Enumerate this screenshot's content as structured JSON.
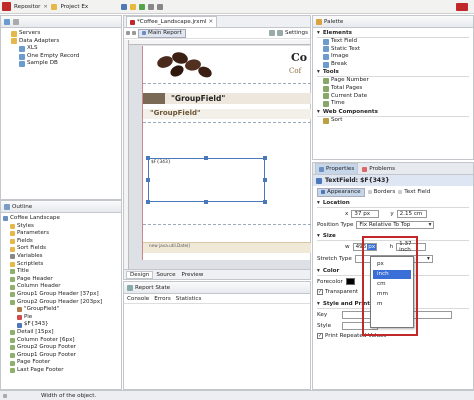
{
  "toolbar": {
    "repo_tab": "Repositor",
    "project_tab": "Project Ex"
  },
  "repository": {
    "items": [
      {
        "label": "Servers",
        "indent": 1
      },
      {
        "label": "Data Adapters",
        "indent": 1
      },
      {
        "label": "XLS",
        "indent": 2
      },
      {
        "label": "One Empty Record",
        "indent": 2
      },
      {
        "label": "Sample DB",
        "indent": 2
      }
    ]
  },
  "editor": {
    "tab_label": "*Coffee_Landscape.jrxml",
    "main_report": "Main Report",
    "settings": "Settings",
    "coffee_text": "Co",
    "coffee_sub": "Cof",
    "group_field_1": "\"GroupField\"",
    "group_field_2": "\"GroupField\"",
    "text_field_ref": "$F{343}",
    "footer_expr": "new java.util.Date()",
    "bottom_tabs": [
      "Design",
      "Source",
      "Preview"
    ]
  },
  "outline": {
    "title": "Outline",
    "items": [
      {
        "label": "Coffee Landscape",
        "indent": 0,
        "icon": "report-icon"
      },
      {
        "label": "Styles",
        "indent": 1,
        "icon": "folder-icon"
      },
      {
        "label": "Parameters",
        "indent": 1,
        "icon": "folder-icon"
      },
      {
        "label": "Fields",
        "indent": 1,
        "icon": "folder-icon"
      },
      {
        "label": "Sort Fields",
        "indent": 1,
        "icon": "folder-icon"
      },
      {
        "label": "Variables",
        "indent": 1,
        "icon": "fx-icon"
      },
      {
        "label": "Scriptlets",
        "indent": 1,
        "icon": "folder-icon"
      },
      {
        "label": "Title",
        "indent": 1,
        "icon": "band-icon"
      },
      {
        "label": "Page Header",
        "indent": 1,
        "icon": "band-icon"
      },
      {
        "label": "Column Header",
        "indent": 1,
        "icon": "band-icon"
      },
      {
        "label": "Group1 Group Header [37px]",
        "indent": 1,
        "icon": "band-icon"
      },
      {
        "label": "Group2 Group Header [203px]",
        "indent": 1,
        "icon": "band-icon"
      },
      {
        "label": "\"GroupField\"",
        "indent": 2,
        "icon": "text-icon"
      },
      {
        "label": "Pie",
        "indent": 2,
        "icon": "pie-icon"
      },
      {
        "label": "$F{343}",
        "indent": 2,
        "icon": "textfield-icon"
      },
      {
        "label": "Detail [15px]",
        "indent": 1,
        "icon": "band-icon"
      },
      {
        "label": "Column Footer [6px]",
        "indent": 1,
        "icon": "band-icon"
      },
      {
        "label": "Group2 Group Footer",
        "indent": 1,
        "icon": "band-icon"
      },
      {
        "label": "Group1 Group Footer",
        "indent": 1,
        "icon": "band-icon"
      },
      {
        "label": "Page Footer",
        "indent": 1,
        "icon": "band-icon"
      },
      {
        "label": "Last Page Footer",
        "indent": 1,
        "icon": "band-icon"
      }
    ]
  },
  "report_state": {
    "title": "Report State",
    "tabs": [
      "Console",
      "Errors",
      "Statistics"
    ]
  },
  "palette": {
    "title": "Palette",
    "elements_header": "Elements",
    "elements": [
      "Text Field",
      "Static Text",
      "Image",
      "Break"
    ],
    "tools_header": "Tools",
    "tools": [
      "Page Number",
      "Total Pages",
      "Current Date",
      "Time"
    ],
    "web_header": "Web Components",
    "web": [
      "Sort"
    ]
  },
  "properties": {
    "tabs": [
      "Properties",
      "Problems"
    ],
    "title": "TextField: $F{343}",
    "subtabs": [
      "Appearance",
      "Borders",
      "Text Field"
    ],
    "location_label": "Location",
    "x_label": "x",
    "x_value": "37 px",
    "y_label": "y",
    "y_value": "2.15 cm",
    "position_type_label": "Position Type",
    "position_type_value": "Fix Relative To Top",
    "size_label": "Size",
    "w_label": "w",
    "w_value": "496",
    "w_unit_sel": "px",
    "h_label": "h",
    "h_value": "1.37 inch",
    "stretch_label": "Stretch Type",
    "unit_options": [
      "px",
      "inch",
      "cm",
      "mm",
      "m"
    ],
    "color_label": "Color",
    "forecolor_label": "Forecolor",
    "transparent_label": "Transparent",
    "style_label": "Style and Print Details",
    "key_label": "Key",
    "style_field_label": "Style",
    "print_repeated": "Print Repeated Values"
  },
  "status": {
    "text": "Width of the object."
  },
  "colors": {
    "highlight": "#c0282a",
    "selected_tab": "#c5d5ea",
    "group_band": "#7a6a55"
  }
}
